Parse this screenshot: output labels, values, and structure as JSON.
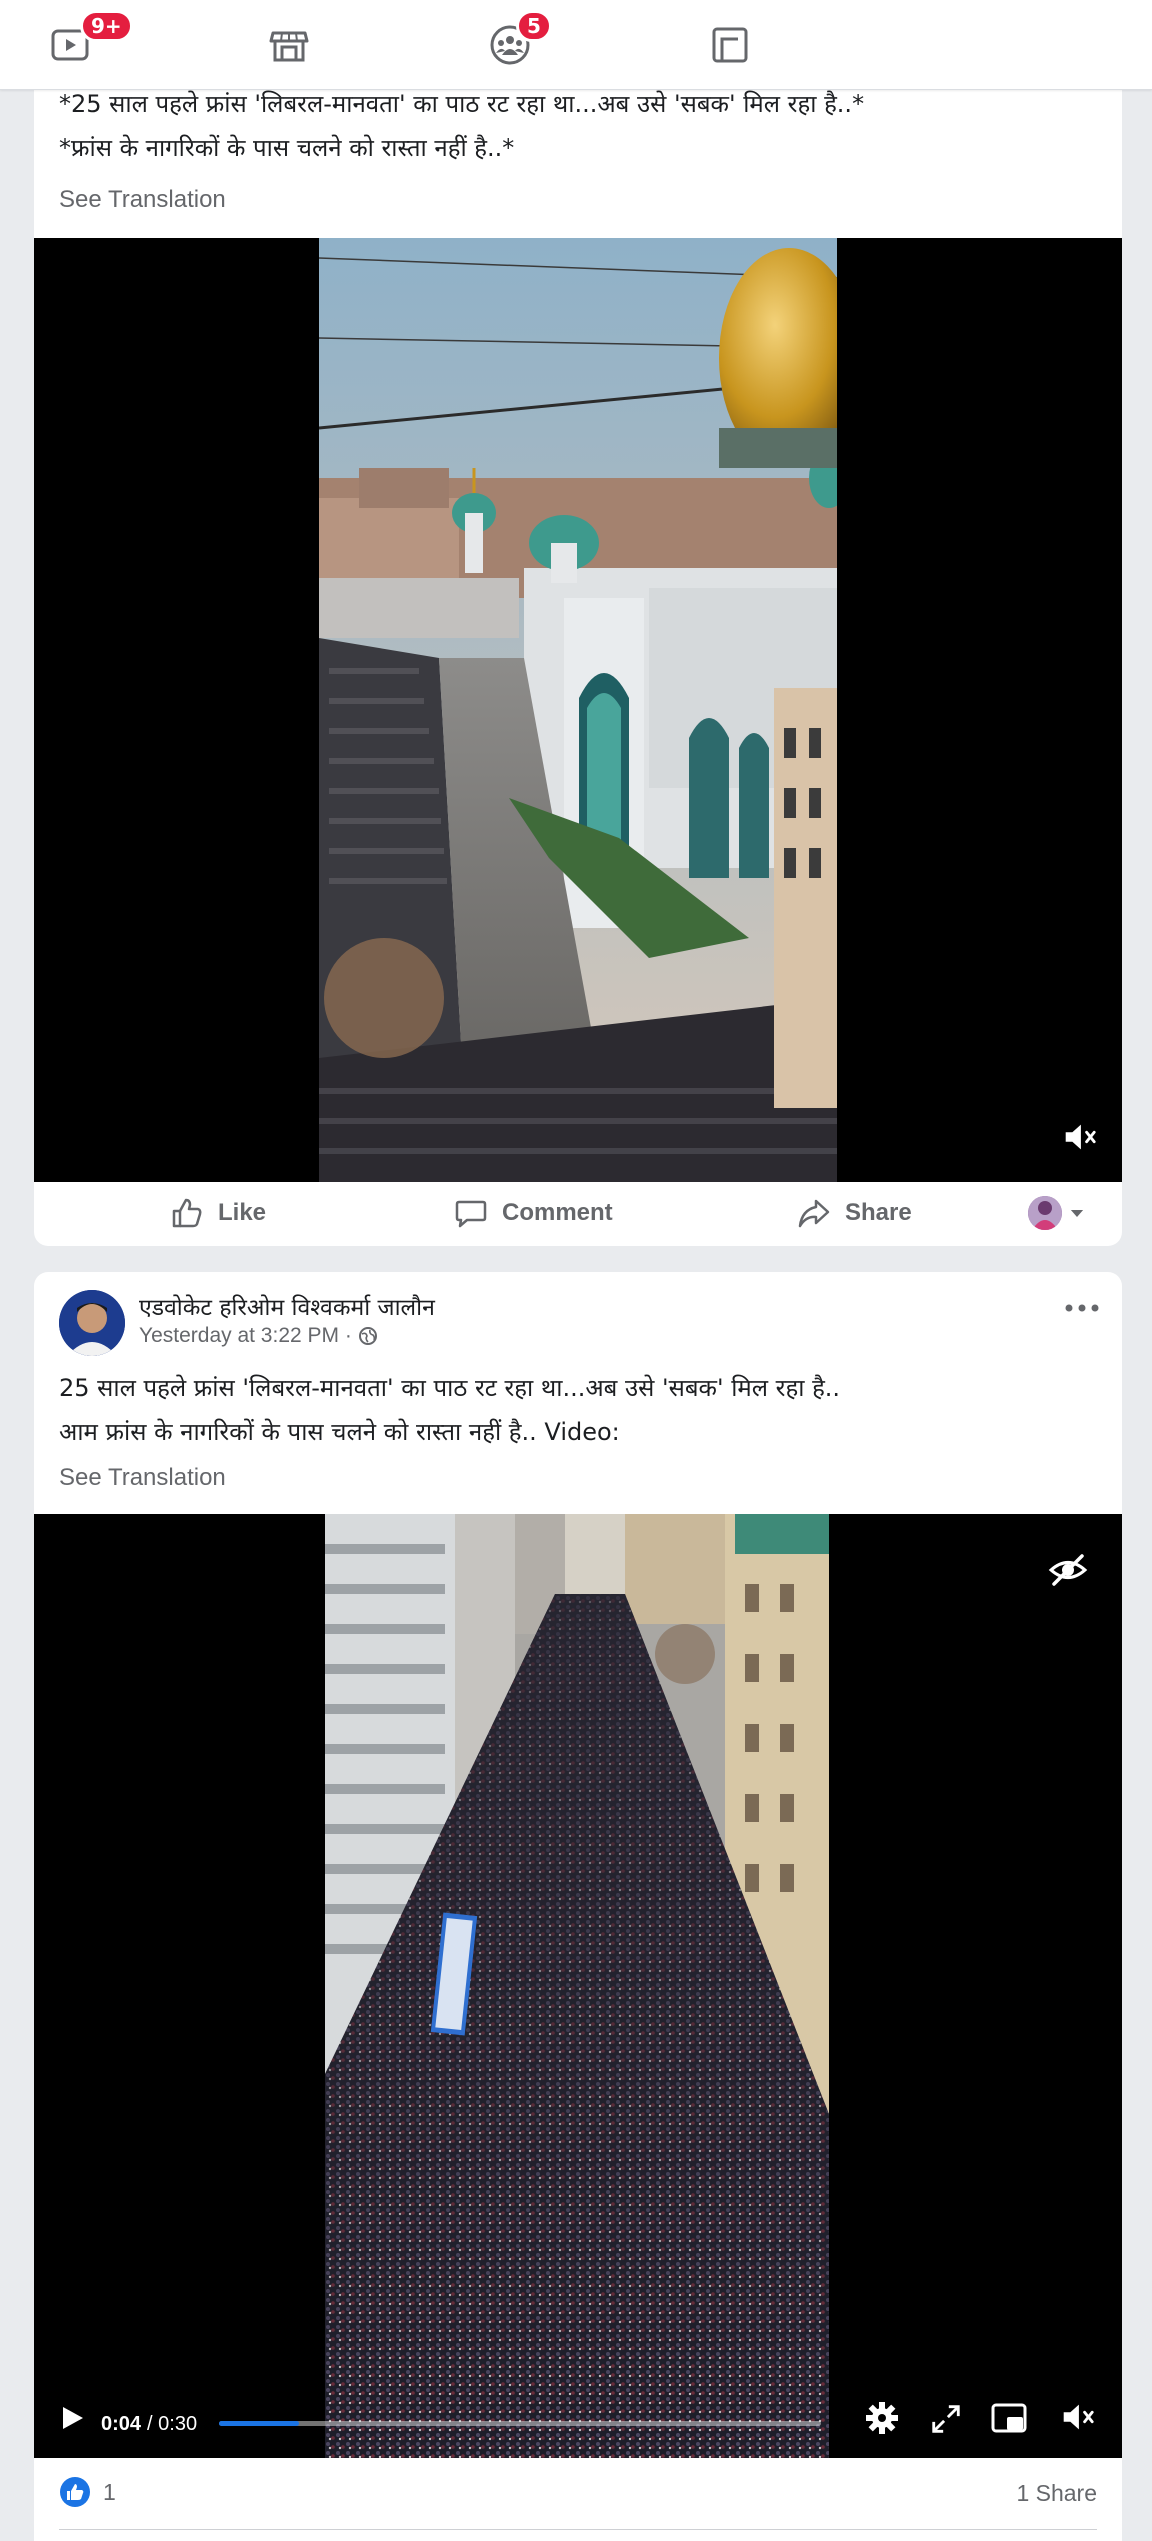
{
  "nav": {
    "watch_badge": "9+",
    "groups_badge": "5"
  },
  "post1": {
    "text_line1": "*25 साल पहले फ्रांस 'लिबरल-मानवता' का पाठ रट रहा था...अब उसे 'सबक' मिल रहा है..*",
    "text_line2": "*फ्रांस के नागरिकों के पास चलने को रास्ता नहीं है..*",
    "see_translation": "See Translation",
    "like_label": "Like",
    "comment_label": "Comment",
    "share_label": "Share"
  },
  "post2": {
    "author": "एडवोकेट हरिओम विश्वकर्मा जालौन",
    "timestamp": "Yesterday at 3:22 PM ·",
    "text_line1": "25 साल पहले फ्रांस 'लिबरल-मानवता' का पाठ रट रहा था...अब उसे 'सबक' मिल रहा है..",
    "text_line2": "आम फ्रांस के नागरिकों के पास चलने को रास्ता नहीं है.. Video:",
    "see_translation": "See Translation",
    "video_time": "0:04",
    "video_duration": "/ 0:30",
    "progress_fraction": 0.133,
    "reaction_count": "1",
    "share_count": "1 Share"
  },
  "colors": {
    "accent": "#1b74e4",
    "badge": "#e41e3f",
    "secondary_text": "#65676b"
  }
}
